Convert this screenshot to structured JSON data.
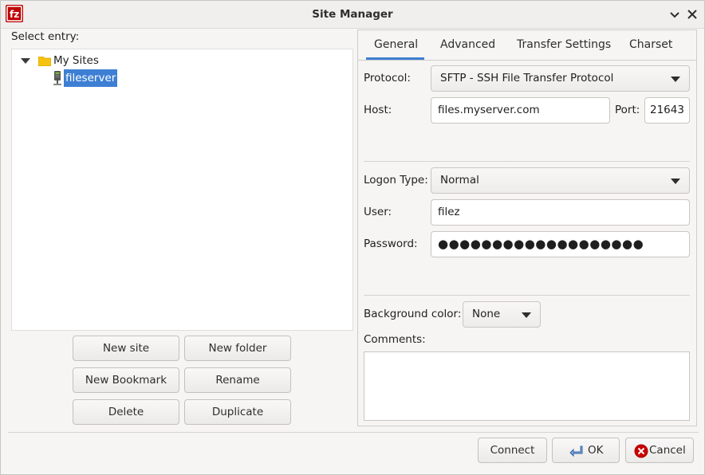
{
  "window": {
    "title": "Site Manager",
    "help_glyph": "✕",
    "close_glyph": "✕"
  },
  "tree": {
    "label": "Select entry:",
    "root": "My Sites",
    "sites": [
      "fileserver"
    ]
  },
  "site_buttons": {
    "new_site": "New site",
    "new_folder": "New folder",
    "new_bookmark": "New Bookmark",
    "rename": "Rename",
    "delete": "Delete",
    "duplicate": "Duplicate"
  },
  "tabs": [
    "General",
    "Advanced",
    "Transfer Settings",
    "Charset"
  ],
  "general": {
    "protocol_label": "Protocol:",
    "protocol_value": "SFTP - SSH File Transfer Protocol",
    "host_label": "Host:",
    "host_value": "files.myserver.com",
    "port_label": "Port:",
    "port_value": "21643",
    "logon_type_label": "Logon Type:",
    "logon_type_value": "Normal",
    "user_label": "User:",
    "user_value": "filez",
    "password_label": "Password:",
    "password_value": "●●●●●●●●●●●●●●●●●●●",
    "background_color_label": "Background color:",
    "background_color_value": "None",
    "comments_label": "Comments:",
    "comments_value": ""
  },
  "dialog_buttons": {
    "connect": "Connect",
    "ok": "OK",
    "cancel": "Cancel"
  },
  "colors": {
    "selection": "#3d7fd3",
    "app_icon": "#bf0000",
    "folder": "#f5c211"
  },
  "icons": {
    "app": "filezilla-icon",
    "folder": "folder-icon",
    "server": "server-icon",
    "ok": "ok-arrow-icon",
    "cancel": "cancel-x-icon"
  }
}
